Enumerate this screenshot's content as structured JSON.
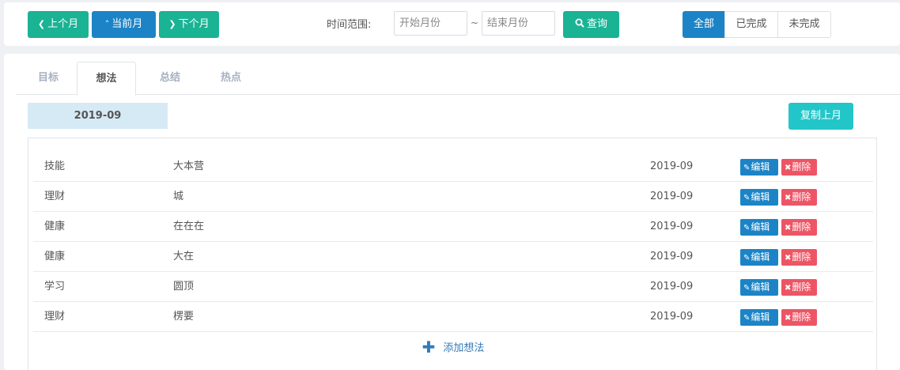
{
  "toolbar": {
    "prev_month": "上个月",
    "current_month": "当前月",
    "next_month": "下个月",
    "range_label": "时间范围:",
    "start_placeholder": "开始月份",
    "range_sep": "~",
    "end_placeholder": "结束月份",
    "query": "查询",
    "filters": [
      "全部",
      "已完成",
      "未完成"
    ],
    "active_filter": "全部"
  },
  "tabs": [
    {
      "label": "目标",
      "active": false
    },
    {
      "label": "想法",
      "active": true
    },
    {
      "label": "总结",
      "active": false
    },
    {
      "label": "热点",
      "active": false
    }
  ],
  "month_badge": "2019-09",
  "copy_last_month": "复制上月",
  "rows": [
    {
      "category": "技能",
      "content": "大本营",
      "month": "2019-09"
    },
    {
      "category": "理财",
      "content": "城",
      "month": "2019-09"
    },
    {
      "category": "健康",
      "content": "在在在",
      "month": "2019-09"
    },
    {
      "category": "健康",
      "content": "大在",
      "month": "2019-09"
    },
    {
      "category": "学习",
      "content": "圆顶",
      "month": "2019-09"
    },
    {
      "category": "理财",
      "content": "楞要",
      "month": "2019-09"
    }
  ],
  "actions": {
    "edit": "编辑",
    "delete": "删除"
  },
  "add_idea": "添加想法",
  "colors": {
    "green": "#1ab394",
    "blue": "#1c84c6",
    "cyan": "#23c6c8",
    "red": "#ed5565",
    "badge_bg": "#d6eaf5"
  },
  "icons": {
    "prev": "chevron-left-icon",
    "current": "chevron-up-icon",
    "next": "chevron-right-icon",
    "query": "search-icon",
    "edit": "edit-icon",
    "delete": "close-icon",
    "add": "plus-icon"
  }
}
